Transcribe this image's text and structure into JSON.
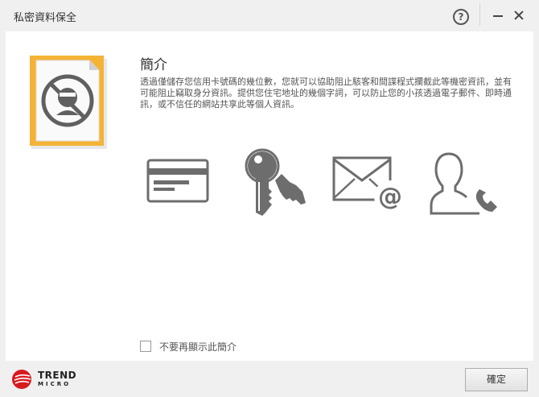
{
  "window": {
    "title": "私密資料保全"
  },
  "titlebar": {
    "help_glyph": "?"
  },
  "main": {
    "heading": "簡介",
    "description": "透過僅儲存您信用卡號碼的幾位數，您就可以協助阻止駭客和間諜程式攔截此等機密資訊，並有可能阻止竊取身分資訊。提供您住宅地址的幾個字詞，可以防止您的小孩透過電子郵件、即時通訊，或不信任的網站共享此等個人資訊。",
    "icons": [
      "credit-card-icon",
      "keys-icon",
      "email-icon",
      "contact-phone-icon"
    ]
  },
  "footer": {
    "checkbox_label": "不要再顯示此簡介",
    "checkbox_checked": false,
    "ok_label": "確定",
    "brand_name": "TREND",
    "brand_sub": "MICRO"
  },
  "colors": {
    "accent": "#f5b335",
    "brand_red": "#d71920",
    "icon_gray": "#6d6d6d"
  }
}
